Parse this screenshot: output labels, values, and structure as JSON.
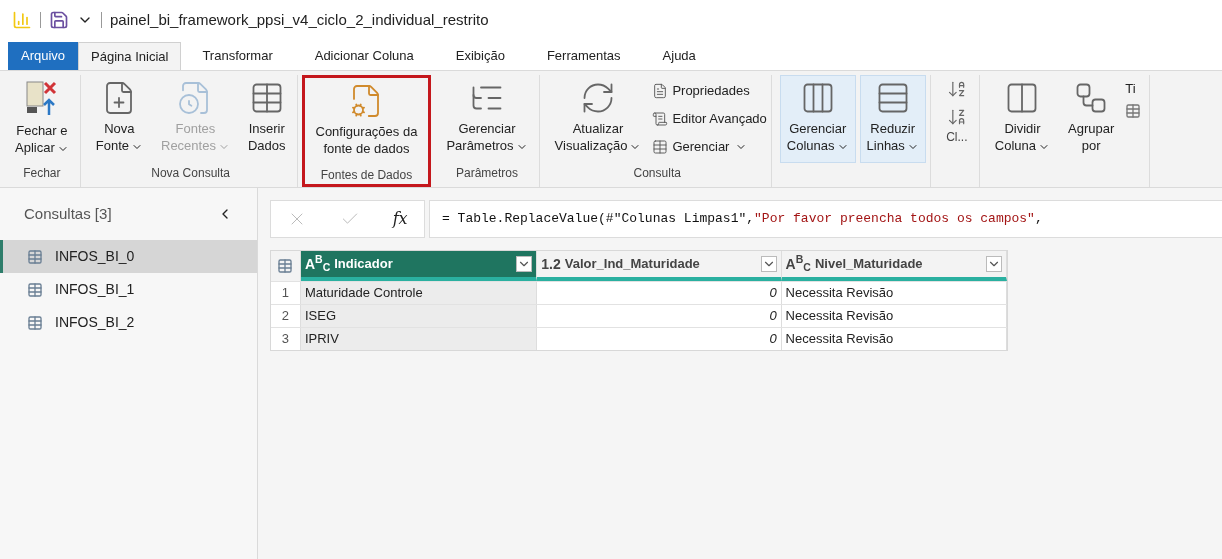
{
  "window": {
    "title": "painel_bi_framework_ppsi_v4_ciclo_2_individual_restrito"
  },
  "tabs": [
    {
      "label": "Arquivo",
      "kind": "file",
      "selected": false
    },
    {
      "label": "Página Inicial",
      "kind": "tab",
      "selected": true
    },
    {
      "label": "Transformar",
      "kind": "tab",
      "selected": false
    },
    {
      "label": "Adicionar Coluna",
      "kind": "tab",
      "selected": false
    },
    {
      "label": "Exibição",
      "kind": "tab",
      "selected": false
    },
    {
      "label": "Ferramentas",
      "kind": "tab",
      "selected": false
    },
    {
      "label": "Ajuda",
      "kind": "tab",
      "selected": false
    }
  ],
  "ribbon": [
    {
      "label": "Fechar",
      "highlighted": false,
      "items": [
        {
          "kind": "large",
          "lines": [
            "Fechar e",
            "Aplicar"
          ],
          "dropdown": true,
          "disabled": false,
          "active": false
        }
      ]
    },
    {
      "label": "Nova Consulta",
      "highlighted": false,
      "items": [
        {
          "kind": "large",
          "lines": [
            "Nova",
            "Fonte"
          ],
          "dropdown": true,
          "disabled": false,
          "active": false
        },
        {
          "kind": "large",
          "lines": [
            "Fontes",
            "Recentes"
          ],
          "dropdown": true,
          "disabled": true,
          "active": false
        },
        {
          "kind": "large",
          "lines": [
            "Inserir",
            "Dados"
          ],
          "dropdown": false,
          "disabled": false,
          "active": false
        }
      ]
    },
    {
      "label": "Fontes de Dados",
      "highlighted": true,
      "items": [
        {
          "kind": "large",
          "lines": [
            "Configurações da",
            "fonte de dados"
          ],
          "dropdown": false,
          "disabled": false,
          "active": false
        }
      ]
    },
    {
      "label": "Parâmetros",
      "highlighted": false,
      "items": [
        {
          "kind": "large",
          "lines": [
            "Gerenciar",
            "Parâmetros"
          ],
          "dropdown": true,
          "disabled": false,
          "active": false
        }
      ]
    },
    {
      "label": "Consulta",
      "highlighted": false,
      "items": [
        {
          "kind": "large",
          "lines": [
            "Atualizar",
            "Visualização"
          ],
          "dropdown": true,
          "disabled": false,
          "active": false
        },
        {
          "kind": "stack",
          "entries": [
            {
              "label": "Propriedades",
              "dropdown": false
            },
            {
              "label": "Editor Avançado",
              "dropdown": false
            },
            {
              "label": "Gerenciar",
              "dropdown": true
            }
          ]
        }
      ]
    },
    {
      "highlighted": false,
      "items": [
        {
          "kind": "large",
          "lines": [
            "Gerenciar",
            "Colunas"
          ],
          "dropdown": true,
          "disabled": false,
          "active": true
        },
        {
          "kind": "large",
          "lines": [
            "Reduzir",
            "Linhas"
          ],
          "dropdown": true,
          "disabled": false,
          "active": true
        }
      ]
    },
    {
      "label": "Cl...",
      "highlighted": false,
      "items": [
        {
          "kind": "icons"
        }
      ]
    },
    {
      "highlighted": false,
      "items": [
        {
          "kind": "large",
          "lines": [
            "Dividir",
            "Coluna"
          ],
          "dropdown": true,
          "disabled": false,
          "active": false
        },
        {
          "kind": "large",
          "lines": [
            "Agrupar",
            "por"
          ],
          "dropdown": false,
          "disabled": false,
          "active": false
        },
        {
          "kind": "cut",
          "label": "Ti"
        }
      ]
    }
  ],
  "sidebar": {
    "title": "Consultas [3]",
    "items": [
      {
        "label": "INFOS_BI_0",
        "selected": true
      },
      {
        "label": "INFOS_BI_1",
        "selected": false
      },
      {
        "label": "INFOS_BI_2",
        "selected": false
      }
    ]
  },
  "formula": {
    "fx": "fx",
    "parts": [
      {
        "kind": "code",
        "text": "= Table.ReplaceValue(#\"Colunas Limpas1\","
      },
      {
        "kind": "string",
        "text": "\"Por favor preencha todos os campos\""
      },
      {
        "kind": "code",
        "text": ","
      }
    ]
  },
  "table": {
    "columns": [
      {
        "type": "A$^{B}$$_{C}$",
        "name": "Indicador",
        "selected": true
      },
      {
        "type": "1.2",
        "name": "Valor_Ind_Maturidade",
        "selected": false
      },
      {
        "type": "A$^{B}$$_{C}$",
        "name": "Nivel_Maturidade",
        "selected": false
      }
    ],
    "rows": [
      {
        "index": "1",
        "cells": [
          "Maturidade Controle",
          "0",
          "Necessita Revisão"
        ]
      },
      {
        "index": "2",
        "cells": [
          "ISEG",
          "0",
          "Necessita Revisão"
        ]
      },
      {
        "index": "3",
        "cells": [
          "IPRIV",
          "0",
          "Necessita Revisão"
        ]
      }
    ]
  }
}
